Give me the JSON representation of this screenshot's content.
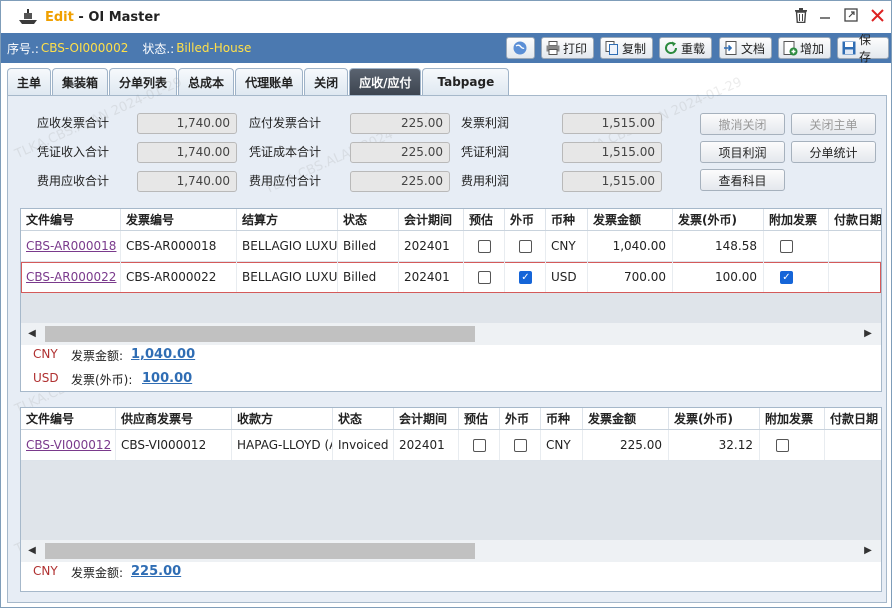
{
  "window": {
    "mode": "Edit",
    "title_sep": " - ",
    "title": "OI Master"
  },
  "info": {
    "no_label": "序号.:",
    "no_value": "CBS-OI000002",
    "status_label": "状态.:",
    "status_value": "Billed-House"
  },
  "toolbar": [
    {
      "label": "",
      "icon": "globe-icon"
    },
    {
      "label": "打印",
      "icon": "print-icon"
    },
    {
      "label": "复制",
      "icon": "copy-icon"
    },
    {
      "label": "重载",
      "icon": "reload-icon"
    },
    {
      "label": "文档",
      "icon": "document-icon"
    },
    {
      "label": "增加",
      "icon": "add-icon"
    },
    {
      "label": "保存",
      "icon": "save-icon"
    }
  ],
  "tabs": [
    "主单",
    "集装箱",
    "分单列表",
    "总成本",
    "代理账单",
    "关闭",
    "应收/应付",
    "Tabpage"
  ],
  "active_tab": 6,
  "summary": {
    "col1": [
      {
        "label": "应收发票合计",
        "value": "1,740.00"
      },
      {
        "label": "凭证收入合计",
        "value": "1,740.00"
      },
      {
        "label": "费用应收合计",
        "value": "1,740.00"
      }
    ],
    "col2": [
      {
        "label": "应付发票合计",
        "value": "225.00"
      },
      {
        "label": "凭证成本合计",
        "value": "225.00"
      },
      {
        "label": "费用应付合计",
        "value": "225.00"
      }
    ],
    "col3": [
      {
        "label": "发票利润",
        "value": "1,515.00"
      },
      {
        "label": "凭证利润",
        "value": "1,515.00"
      },
      {
        "label": "费用利润",
        "value": "1,515.00"
      }
    ]
  },
  "actions": {
    "cancel_close": "撤消关闭",
    "close_master": "关闭主单",
    "project_profit": "项目利润",
    "hbl_stats": "分单统计",
    "view_accounts": "查看科目"
  },
  "ar_grid": {
    "headers": [
      "文件编号",
      "发票编号",
      "结算方",
      "状态",
      "会计期间",
      "预估",
      "外币",
      "币种",
      "发票金额",
      "发票(外币)",
      "附加发票",
      "付款日期"
    ],
    "rows": [
      {
        "file_no": "CBS-AR000018",
        "invoice_no": "CBS-AR000018",
        "party": "BELLAGIO LUXURY",
        "status": "Billed",
        "period": "202401",
        "est": false,
        "fx": false,
        "cur": "CNY",
        "amount": "1,040.00",
        "amount_fx": "148.58",
        "extra": false
      },
      {
        "file_no": "CBS-AR000022",
        "invoice_no": "CBS-AR000022",
        "party": "BELLAGIO LUXURY",
        "status": "Billed",
        "period": "202401",
        "est": false,
        "fx": true,
        "cur": "USD",
        "amount": "700.00",
        "amount_fx": "100.00",
        "extra": true
      }
    ],
    "totals": [
      {
        "cur": "CNY",
        "label": "发票金额:",
        "value": "1,040.00"
      },
      {
        "cur": "USD",
        "label": "发票(外币):",
        "value": "100.00"
      }
    ]
  },
  "ap_grid": {
    "headers": [
      "文件编号",
      "供应商发票号",
      "收款方",
      "状态",
      "会计期间",
      "预估",
      "外币",
      "币种",
      "发票金额",
      "发票(外币)",
      "附加发票",
      "付款日期"
    ],
    "rows": [
      {
        "file_no": "CBS-VI000012",
        "invoice_no": "CBS-VI000012",
        "party": "HAPAG-LLOYD (A",
        "status": "Invoiced",
        "period": "202401",
        "est": false,
        "fx": false,
        "cur": "CNY",
        "amount": "225.00",
        "amount_fx": "32.12",
        "extra": false
      }
    ],
    "totals": [
      {
        "cur": "CNY",
        "label": "发票金额:",
        "value": "225.00"
      }
    ]
  },
  "watermark": "TLKA.CBS.ALAN 2024-01-29"
}
